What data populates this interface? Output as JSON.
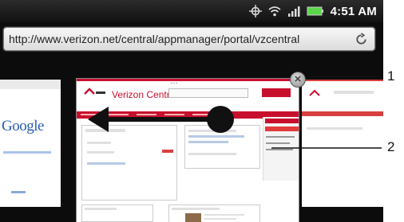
{
  "status_bar": {
    "time": "4:51 AM",
    "icons": [
      "gps-icon",
      "wifi-icon",
      "signal-icon",
      "battery-icon"
    ],
    "battery_color": "#5bd64a"
  },
  "address_bar": {
    "url": "http://www.verizon.net/central/appmanager/portal/vzcentral",
    "refresh_icon": "refresh-icon"
  },
  "tabs": {
    "left_page_text": "Google",
    "current_page_title": "Verizon Central",
    "brand_color": "#c8102e",
    "close_icon": "close-icon"
  },
  "gesture": {
    "direction": "left",
    "arrow_icon": "swipe-left-arrow-icon"
  },
  "callouts": {
    "one": "1",
    "two": "2"
  }
}
